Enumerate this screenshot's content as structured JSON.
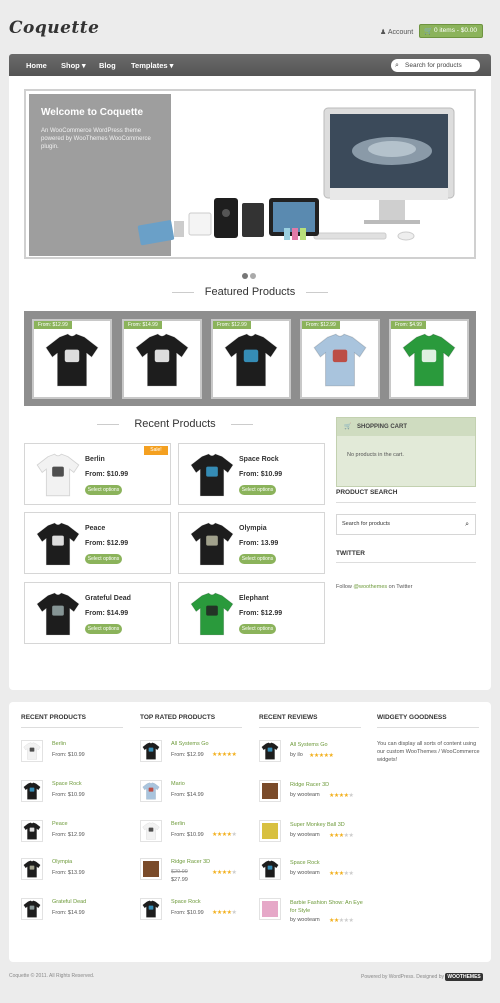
{
  "header": {
    "logo": "Coquette",
    "account": "Account",
    "cart": "0 items - $0.00"
  },
  "nav": {
    "home": "Home",
    "shop": "Shop",
    "blog": "Blog",
    "templates": "Templates",
    "search_placeholder": "Search for products"
  },
  "slider": {
    "title": "Welcome to Coquette",
    "desc": "An WooCommerce WordPress theme powered by WooThemes WooCommerce plugin."
  },
  "featured": {
    "heading": "Featured Products",
    "items": [
      {
        "tag": "From: $12.99",
        "shirt": "PEACE",
        "color": "#1d1d1d",
        "print": "#fff"
      },
      {
        "tag": "From: $14.99",
        "shirt": "BEYOND THE MOON",
        "color": "#1d1d1d",
        "print": "#fff"
      },
      {
        "tag": "From: $12.99",
        "shirt": "SYSTEMS GO",
        "color": "#1d1d1d",
        "print": "#3aa0d0"
      },
      {
        "tag": "From: $12.99",
        "shirt": "MARIO",
        "color": "#a9c4dd",
        "print": "#c0392b"
      },
      {
        "tag": "From: $4.99",
        "shirt": "1UP",
        "color": "#2a9a3c",
        "print": "#fff"
      }
    ]
  },
  "recent": {
    "heading": "Recent Products",
    "items": [
      {
        "name": "Berlin",
        "price": "From: $10.99",
        "btn": "Select options",
        "sale": "Sale!"
      },
      {
        "name": "Space Rock",
        "price": "From: $10.99",
        "btn": "Select options"
      },
      {
        "name": "Peace",
        "price": "From: $12.99",
        "btn": "Select options"
      },
      {
        "name": "Olympia",
        "price": "From: 13.99",
        "btn": "Select options"
      },
      {
        "name": "Grateful Dead",
        "price": "From: $14.99",
        "btn": "Select options"
      },
      {
        "name": "Elephant",
        "price": "From: $12.99",
        "btn": "Select options"
      }
    ]
  },
  "sidebar": {
    "cart_title": "SHOPPING CART",
    "cart_empty": "No products in the cart.",
    "search_title": "PRODUCT SEARCH",
    "search_placeholder": "Search for products",
    "twitter_title": "TWITTER",
    "twitter_pre": "Follow ",
    "twitter_link": "@woothemes",
    "twitter_post": " on Twitter"
  },
  "footer": {
    "recent_title": "RECENT PRODUCTS",
    "recent": [
      {
        "name": "Berlin",
        "price": "From: $10.99"
      },
      {
        "name": "Space Rock",
        "price": "From: $10.99"
      },
      {
        "name": "Peace",
        "price": "From: $12.99"
      },
      {
        "name": "Olympia",
        "price": "From: $13.99"
      },
      {
        "name": "Grateful Dead",
        "price": "From: $14.99"
      }
    ],
    "rated_title": "TOP RATED PRODUCTS",
    "rated": [
      {
        "name": "All Systems Go",
        "price": "From: $12.99",
        "stars": 5
      },
      {
        "name": "Mario",
        "price": "From: $14.99",
        "stars": 0
      },
      {
        "name": "Berlin",
        "price": "From: $10.99",
        "stars": 4
      },
      {
        "name": "Ridge Racer 3D",
        "old": "$29.99",
        "price": "$27.99",
        "stars": 4
      },
      {
        "name": "Space Rock",
        "price": "From: $10.99",
        "stars": 4
      }
    ],
    "reviews_title": "RECENT REVIEWS",
    "reviews": [
      {
        "name": "All Systems Go",
        "by": "by ilo",
        "stars": 5
      },
      {
        "name": "Ridge Racer 3D",
        "by": "by wooteam",
        "stars": 4
      },
      {
        "name": "Super Monkey Ball 3D",
        "by": "by wooteam",
        "stars": 3
      },
      {
        "name": "Space Rock",
        "by": "by wooteam",
        "stars": 3
      },
      {
        "name": "Barbie Fashion Show: An Eye for Style",
        "by": "by wooteam",
        "stars": 2
      }
    ],
    "widgety_title": "WIDGETY GOODNESS",
    "widgety_text": "You can display all sorts of content using our custom WooThemes / WooCommerce widgets!"
  },
  "bottom": {
    "copyright": "Coquette © 2011. All Rights Reserved.",
    "powered": "Powered by WordPress. Designed by",
    "woo": "WOOTHEMES"
  },
  "colors": {
    "accent": "#8bb35b",
    "nav": "#5e5e5e",
    "sale": "#f4a020"
  }
}
